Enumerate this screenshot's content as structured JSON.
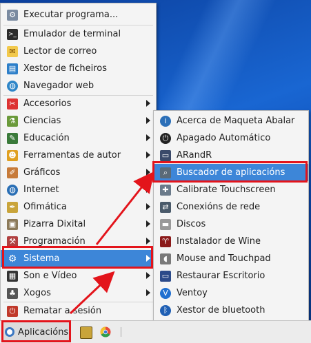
{
  "main_menu": {
    "items": [
      {
        "label": "Executar programa...",
        "icon": "gear-run-icon",
        "submenu": false
      },
      {
        "label": "Emulador de terminal",
        "icon": "terminal-icon",
        "submenu": false
      },
      {
        "label": "Lector de correo",
        "icon": "mail-icon",
        "submenu": false
      },
      {
        "label": "Xestor de ficheiros",
        "icon": "file-manager-icon",
        "submenu": false
      },
      {
        "label": "Navegador web",
        "icon": "globe-icon",
        "submenu": false
      },
      {
        "label": "Accesorios",
        "icon": "accessories-icon",
        "submenu": true
      },
      {
        "label": "Ciencias",
        "icon": "science-icon",
        "submenu": true
      },
      {
        "label": "Educación",
        "icon": "education-icon",
        "submenu": true
      },
      {
        "label": "Ferramentas de autor",
        "icon": "authoring-icon",
        "submenu": true
      },
      {
        "label": "Gráficos",
        "icon": "graphics-icon",
        "submenu": true
      },
      {
        "label": "Internet",
        "icon": "internet-icon",
        "submenu": true
      },
      {
        "label": "Ofimática",
        "icon": "office-icon",
        "submenu": true
      },
      {
        "label": "Pizarra Dixital",
        "icon": "whiteboard-icon",
        "submenu": true
      },
      {
        "label": "Programación",
        "icon": "programming-icon",
        "submenu": true
      },
      {
        "label": "Sistema",
        "icon": "system-icon",
        "submenu": true,
        "selected": true
      },
      {
        "label": "Son e Vídeo",
        "icon": "multimedia-icon",
        "submenu": true
      },
      {
        "label": "Xogos",
        "icon": "games-icon",
        "submenu": true
      },
      {
        "label": "Rematar a sesión",
        "icon": "logout-icon",
        "submenu": false
      }
    ]
  },
  "submenu": {
    "items": [
      {
        "label": "Acerca de Maqueta Abalar",
        "icon": "about-icon"
      },
      {
        "label": "Apagado Automático",
        "icon": "shutdown-icon"
      },
      {
        "label": "ARandR",
        "icon": "display-icon"
      },
      {
        "label": "Buscador de aplicacións",
        "icon": "search-icon",
        "selected": true
      },
      {
        "label": "Calibrate Touchscreen",
        "icon": "touchscreen-icon"
      },
      {
        "label": "Conexións de rede",
        "icon": "network-icon"
      },
      {
        "label": "Discos",
        "icon": "disk-icon"
      },
      {
        "label": "Instalador de Wine",
        "icon": "wine-icon"
      },
      {
        "label": "Mouse and Touchpad",
        "icon": "mouse-icon"
      },
      {
        "label": "Restaurar Escritorio",
        "icon": "restore-desktop-icon"
      },
      {
        "label": "Ventoy",
        "icon": "ventoy-icon"
      },
      {
        "label": "Xestor de bluetooth",
        "icon": "bluetooth-icon"
      }
    ]
  },
  "taskbar": {
    "apps_label": "Aplicacións"
  },
  "colors": {
    "selection": "#3d86d8",
    "highlight": "#e3141b",
    "desktop": "#1966d2"
  }
}
